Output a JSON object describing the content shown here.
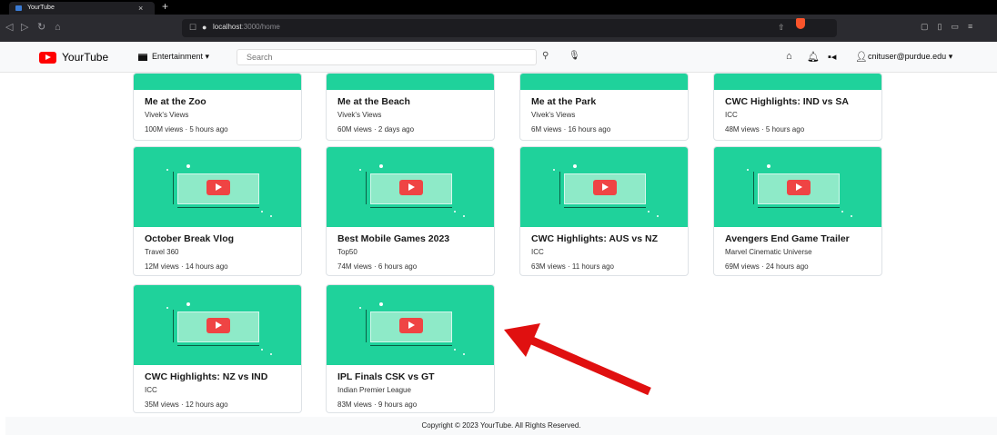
{
  "browser": {
    "tab_title": "YourTube",
    "tab_close": "×",
    "new_tab": "+",
    "url_host": "localhost",
    "url_path": ":3000/home"
  },
  "header": {
    "brand": "YourTube",
    "category": "Entertainment ▾",
    "search_placeholder": "Search",
    "user": "cnituser@purdue.edu ▾"
  },
  "icons": [
    "back-icon",
    "forward-icon",
    "reload-icon",
    "home-icon",
    "bookmark-icon",
    "lock-icon",
    "share-icon",
    "brave-shield-icon",
    "search-icon",
    "mic-icon",
    "home-icon",
    "bell-icon",
    "video-camera-icon",
    "user-icon"
  ],
  "videos": [
    {
      "title": "Me at the Zoo",
      "channel": "Vivek's Views",
      "meta": "100M views · 5 hours ago"
    },
    {
      "title": "Me at the Beach",
      "channel": "Vivek's Views",
      "meta": "60M views · 2 days ago"
    },
    {
      "title": "Me at the Park",
      "channel": "Vivek's Views",
      "meta": "6M views · 16 hours ago"
    },
    {
      "title": "CWC Highlights: IND vs SA",
      "channel": "ICC",
      "meta": "48M views · 5 hours ago"
    },
    {
      "title": "October Break Vlog",
      "channel": "Travel 360",
      "meta": "12M views · 14 hours ago"
    },
    {
      "title": "Best Mobile Games 2023",
      "channel": "Top50",
      "meta": "74M views · 6 hours ago"
    },
    {
      "title": "CWC Highlights: AUS vs NZ",
      "channel": "ICC",
      "meta": "63M views · 11 hours ago"
    },
    {
      "title": "Avengers End Game Trailer",
      "channel": "Marvel Cinematic Universe",
      "meta": "69M views · 24 hours ago"
    },
    {
      "title": "CWC Highlights: NZ vs IND",
      "channel": "ICC",
      "meta": "35M views · 12 hours ago"
    },
    {
      "title": "IPL Finals CSK vs GT",
      "channel": "Indian Premier League",
      "meta": "83M views · 9 hours ago"
    }
  ],
  "footer": "Copyright © 2023 YourTube. All Rights Reserved.",
  "colors": {
    "thumbnail": "#1fd29b",
    "play": "#ef4444",
    "arrow": "#e01010",
    "brand": "#ff0000"
  }
}
